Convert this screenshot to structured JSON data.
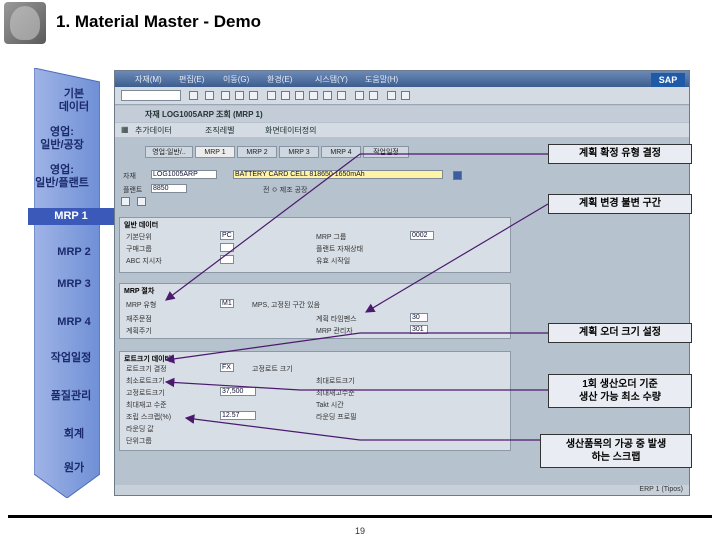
{
  "slide": {
    "title": "1. Material Master - Demo",
    "page_number": "19"
  },
  "nav": {
    "items": [
      {
        "label": "기본\n데이터"
      },
      {
        "label": "영업:\n일반/공장"
      },
      {
        "label": "영업:\n일반/플랜트"
      },
      {
        "label": "MRP 1"
      },
      {
        "label": "MRP 2"
      },
      {
        "label": "MRP 3"
      },
      {
        "label": "MRP 4"
      },
      {
        "label": "작업일정"
      },
      {
        "label": "품질관리"
      },
      {
        "label": "회계"
      },
      {
        "label": "원가"
      }
    ],
    "active_index": 3
  },
  "sap": {
    "menu": [
      "자재(M)",
      "편집(E)",
      "이동(G)",
      "환경(E)",
      "시스템(Y)",
      "도움말(H)"
    ],
    "logo": "SAP",
    "title": "자재 LOG1005ARP 조회 (MRP 1)",
    "apptool": [
      "추가데이터",
      "조직레벨",
      "화면데이터정의"
    ],
    "tabs": [
      "영업:일반/..",
      "MRP 1",
      "MRP 2",
      "MRP 3",
      "MRP 4",
      "작업일정"
    ],
    "material_label": "자재",
    "material_value": "LOG1005ARP",
    "material_desc": "BATTERY CARD CELL 818650 1650mAh",
    "plant_label": "플랜트",
    "plant_value": "8850",
    "plant_desc": "전 ㅇ 제조 공장",
    "groups": {
      "general": "일반 데이터",
      "mrp_procedure": "MRP 절차",
      "lot_size": "로트크기 데이터"
    },
    "general_fields": [
      {
        "label": "기본단위",
        "value": "PC"
      },
      {
        "label": "구매그룹",
        "value": ""
      },
      {
        "label": "ABC 지시자",
        "value": ""
      }
    ],
    "general_fields_right": [
      {
        "label": "MRP 그룹",
        "value": "0002"
      },
      {
        "label": "플랜트 자재상태",
        "value": ""
      },
      {
        "label": "유효 시작일",
        "value": ""
      }
    ],
    "mrp_fields": [
      {
        "label": "MRP 유형",
        "value": "M1"
      },
      {
        "label": "재주문점",
        "value": ""
      },
      {
        "label": "계획주기",
        "value": ""
      }
    ],
    "mrp_extra": "MPS, 고정된 구간 있음",
    "mrp_fields_right": [
      {
        "label": "계획 타임펜스",
        "value": "30"
      },
      {
        "label": "MRP 관리자",
        "value": "301"
      }
    ],
    "lot_fields": [
      {
        "label": "로트크기 결정",
        "value": "FX"
      },
      {
        "label": "최소로트크기",
        "value": ""
      },
      {
        "label": "고정로트크기",
        "value": "37,500"
      },
      {
        "label": "최대재고 수준",
        "value": ""
      },
      {
        "label": "조립 스크랩(%)",
        "value": "12.57"
      },
      {
        "label": "라운딩 값",
        "value": ""
      },
      {
        "label": "단위그룹",
        "value": ""
      }
    ],
    "lot_extra": "고정로트 크기",
    "lot_fields_right": [
      {
        "label": "최대로트크기",
        "value": ""
      },
      {
        "label": "최대재고수준",
        "value": ""
      },
      {
        "label": "Takt 시간",
        "value": ""
      },
      {
        "label": "라운딩 프로필",
        "value": ""
      }
    ],
    "status": "ERP 1 (Tipos)"
  },
  "callouts": [
    {
      "text": "계획 확정 유형 결정"
    },
    {
      "text": "계획 변경 불변 구간"
    },
    {
      "text": "계획 오더 크기 설정"
    },
    {
      "text": "1회 생산오더 기준\n생산 가능 최소 수량"
    },
    {
      "text": "생산품목의 가공 중 발생\n하는 스크랩"
    }
  ],
  "colors": {
    "nav_active": "#3a59b8",
    "sap_header": "#3d5d8f",
    "arrow": "#4b1a6e"
  }
}
